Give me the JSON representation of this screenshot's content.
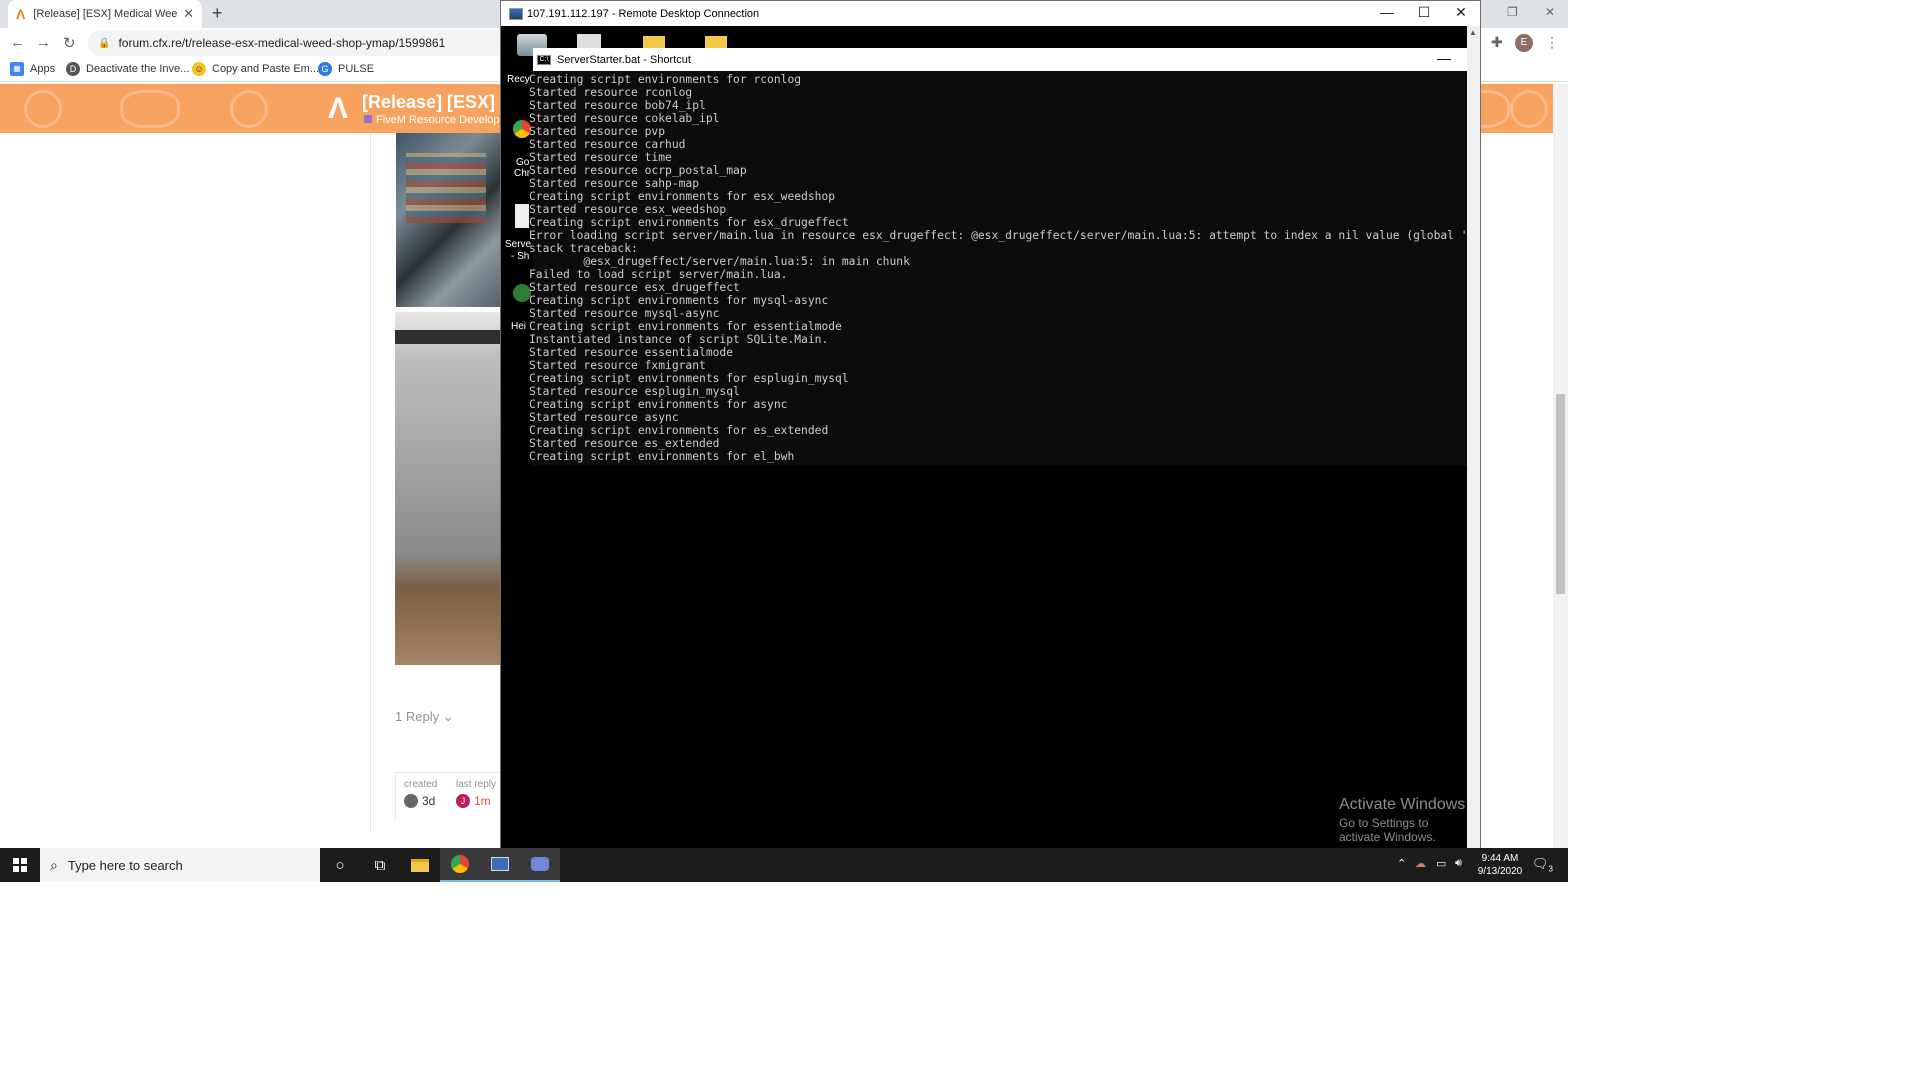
{
  "browser": {
    "tab_title": "[Release] [ESX] Medical Weed Sh",
    "tab_favicon": "Λ",
    "url": "forum.cfx.re/t/release-esx-medical-weed-shop-ymap/1599861",
    "avatar_letter": "E",
    "bookmarks": [
      {
        "label": "Apps",
        "icon": "apps-grid-icon"
      },
      {
        "label": "Deactivate the Inve...",
        "icon": "site-icon"
      },
      {
        "label": "Copy and Paste Em...",
        "icon": "emoji-icon"
      },
      {
        "label": "PULSE",
        "icon": "pulse-icon"
      }
    ]
  },
  "forum": {
    "logo": "Λ",
    "title": "[Release] [ESX] M",
    "category": "FiveM Resource Developm",
    "reply_link": "1 Reply",
    "meta": {
      "created_label": "created",
      "created_value": "3d",
      "last_reply_label": "last reply",
      "last_reply_value": "1m",
      "last_reply_avatar": "J"
    },
    "header_color": "#f7a35f"
  },
  "rdp": {
    "title": "107.191.112.197 - Remote Desktop Connection",
    "desktop_labels": [
      "Recy",
      "Go",
      "Chr",
      "Serve",
      "- Sh",
      "Hei"
    ],
    "cmd_title": "ServerStarter.bat - Shortcut",
    "console_lines": [
      "Creating script environments for rconlog",
      "Started resource rconlog",
      "Started resource bob74_ipl",
      "Started resource cokelab_ipl",
      "Started resource pvp",
      "Started resource carhud",
      "Started resource time",
      "Started resource ocrp_postal_map",
      "Started resource sahp-map",
      "Creating script environments for esx_weedshop",
      "Started resource esx_weedshop",
      "Creating script environments for esx_drugeffect",
      "Error loading script server/main.lua in resource esx_drugeffect: @esx_drugeffect/server/main.lua:5: attempt to index a nil value (global 'ESX')",
      "stack traceback:",
      "        @esx_drugeffect/server/main.lua:5: in main chunk",
      "Failed to load script server/main.lua.",
      "Started resource esx_drugeffect",
      "Creating script environments for mysql-async",
      "Started resource mysql-async",
      "Creating script environments for essentialmode",
      "Instantiated instance of script SQLite.Main.",
      "Started resource essentialmode",
      "Started resource fxmigrant",
      "Creating script environments for esplugin_mysql",
      "Started resource esplugin_mysql",
      "Creating script environments for async",
      "Started resource async",
      "Creating script environments for es_extended",
      "Started resource es_extended",
      "Creating script environments for el_bwh"
    ],
    "watermark_line1": "Activate Windows",
    "watermark_line2": "Go to Settings to activate Windows."
  },
  "taskbar": {
    "search_placeholder": "Type here to search",
    "time": "9:44 AM",
    "date": "9/13/2020",
    "notification_count": "3",
    "accent": "#76b9ed"
  }
}
